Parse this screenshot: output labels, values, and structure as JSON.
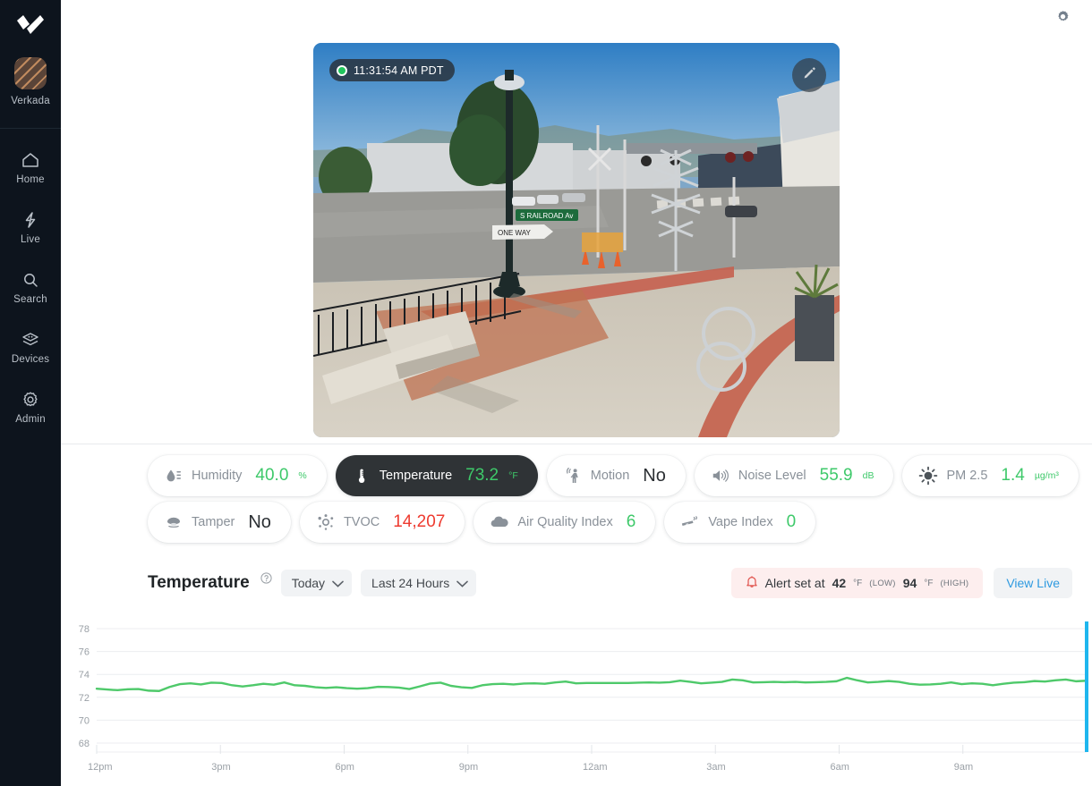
{
  "sidebar": {
    "logo_icon": "verkada-checkmark-logo",
    "org": {
      "label": "Verkada",
      "avatar_icon": "org-avatar"
    },
    "items": [
      {
        "label": "Home",
        "icon": "home-icon"
      },
      {
        "label": "Live",
        "icon": "lightning-bolt-icon"
      },
      {
        "label": "Search",
        "icon": "search-icon"
      },
      {
        "label": "Devices",
        "icon": "devices-stack-icon"
      },
      {
        "label": "Admin",
        "icon": "gear-icon"
      }
    ]
  },
  "topbar": {
    "settings_icon": "gear-icon"
  },
  "video": {
    "timestamp": "11:31:54 AM PDT",
    "recording_indicator": "recording-dot",
    "edit_icon": "pencil-icon",
    "scene_text": {
      "street_sign": "S RAILROAD Ave",
      "one_way_sign": "ONE WAY"
    }
  },
  "sensors": {
    "row1": [
      {
        "name": "humidity",
        "icon": "water-drop-icon",
        "label": "Humidity",
        "value": "40.0",
        "unit": "%",
        "value_color": "#3ec96a",
        "unit_color": "#3ec96a",
        "active": false
      },
      {
        "name": "temperature",
        "icon": "thermometer-icon",
        "label": "Temperature",
        "value": "73.2",
        "unit": "°F",
        "value_color": "#3ec96a",
        "unit_color": "#3ec96a",
        "active": true
      },
      {
        "name": "motion",
        "icon": "motion-person-icon",
        "label": "Motion",
        "value": "No",
        "unit": "",
        "value_color": "#2b2f33",
        "unit_color": "",
        "active": false
      },
      {
        "name": "noise-level",
        "icon": "speaker-icon",
        "label": "Noise Level",
        "value": "55.9",
        "unit": "dB",
        "value_color": "#3ec96a",
        "unit_color": "#3ec96a",
        "active": false
      },
      {
        "name": "pm-2-5",
        "icon": "particulate-icon",
        "label": "PM 2.5",
        "value": "1.4",
        "unit": "µg/m³",
        "value_color": "#3ec96a",
        "unit_color": "#3ec96a",
        "active": false
      }
    ],
    "row2": [
      {
        "name": "tamper",
        "icon": "tamper-icon",
        "label": "Tamper",
        "value": "No",
        "unit": "",
        "value_color": "#2b2f33",
        "unit_color": "",
        "active": false
      },
      {
        "name": "tvoc",
        "icon": "tvoc-icon",
        "label": "TVOC",
        "value": "14,207",
        "unit": "",
        "value_color": "#ee3b30",
        "unit_color": "",
        "active": false
      },
      {
        "name": "air-quality-index",
        "icon": "cloud-icon",
        "label": "Air Quality Index",
        "value": "6",
        "unit": "",
        "value_color": "#3ec96a",
        "unit_color": "",
        "active": false
      },
      {
        "name": "vape-index",
        "icon": "vape-pen-icon",
        "label": "Vape Index",
        "value": "0",
        "unit": "",
        "value_color": "#3ec96a",
        "unit_color": "",
        "active": false
      }
    ]
  },
  "chart_header": {
    "title": "Temperature",
    "help_icon": "help-circle-icon",
    "day_select": {
      "value": "Today",
      "icon": "chevron-down-icon"
    },
    "range_select": {
      "value": "Last 24 Hours",
      "icon": "chevron-down-icon"
    },
    "alert": {
      "icon": "bell-icon",
      "prefix": "Alert set at",
      "low_value": "42",
      "low_unit": "°F",
      "low_tag": "(LOW)",
      "high_value": "94",
      "high_unit": "°F",
      "high_tag": "(HIGH)"
    },
    "view_live_label": "View Live"
  },
  "chart_data": {
    "type": "line",
    "title": "Temperature",
    "xlabel": "",
    "ylabel": "",
    "ylim": [
      68,
      78
    ],
    "grid": true,
    "legend": false,
    "series_color": "#4ec96a",
    "current_time_marker_color": "#1fb6ee",
    "ytick_labels": [
      "78",
      "76",
      "74",
      "72",
      "70",
      "68"
    ],
    "ytick_values": [
      78,
      76,
      74,
      72,
      70,
      68
    ],
    "xtick_labels": [
      "12pm",
      "3pm",
      "6pm",
      "9pm",
      "12am",
      "3am",
      "6am",
      "9am"
    ],
    "xtick_hours": [
      0,
      3,
      6,
      9,
      12,
      15,
      18,
      21
    ],
    "x_hours_span": 24,
    "series": [
      {
        "name": "Temperature (°F)",
        "values": [
          72.75,
          72.68,
          72.62,
          72.7,
          72.72,
          72.58,
          72.55,
          72.9,
          73.15,
          73.22,
          73.12,
          73.28,
          73.25,
          73.05,
          72.95,
          73.05,
          73.18,
          73.1,
          73.3,
          73.05,
          73.0,
          72.88,
          72.82,
          72.88,
          72.8,
          72.75,
          72.8,
          72.92,
          72.9,
          72.85,
          72.72,
          72.95,
          73.2,
          73.28,
          73.0,
          72.88,
          72.82,
          73.05,
          73.15,
          73.18,
          73.12,
          73.2,
          73.22,
          73.18,
          73.3,
          73.38,
          73.22,
          73.25,
          73.25,
          73.25,
          73.25,
          73.25,
          73.28,
          73.3,
          73.28,
          73.32,
          73.45,
          73.35,
          73.22,
          73.28,
          73.35,
          73.55,
          73.48,
          73.3,
          73.32,
          73.35,
          73.32,
          73.35,
          73.3,
          73.32,
          73.35,
          73.4,
          73.7,
          73.48,
          73.3,
          73.35,
          73.42,
          73.35,
          73.18,
          73.1,
          73.12,
          73.18,
          73.3,
          73.15,
          73.22,
          73.18,
          73.05,
          73.18,
          73.28,
          73.32,
          73.42,
          73.38,
          73.48,
          73.55,
          73.4,
          73.45
        ]
      }
    ],
    "data_range": {
      "min": 72.55,
      "max": 73.7,
      "last": 73.45,
      "unit": "°F"
    }
  }
}
